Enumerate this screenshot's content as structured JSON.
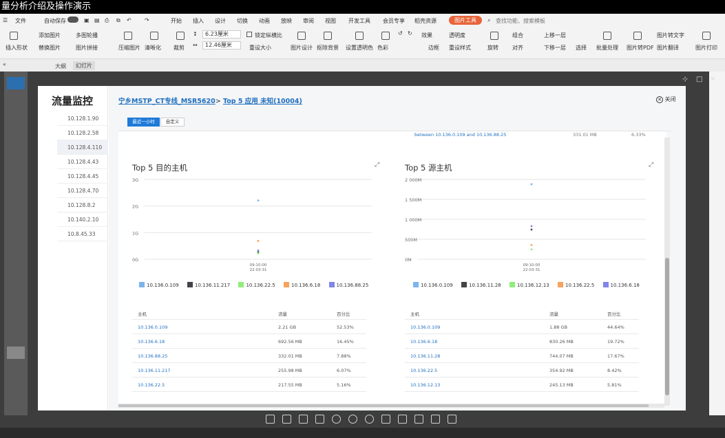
{
  "window": {
    "title": "量分析介绍及操作演示"
  },
  "menubar": {
    "file": "文件",
    "autosave": "自动保存",
    "tabs": [
      "开始",
      "插入",
      "设计",
      "切换",
      "动画",
      "放映",
      "审阅",
      "视图",
      "开发工具",
      "会员专享",
      "稻壳资源"
    ],
    "picture_tools": "图片工具",
    "search_placeholder": "查找功能、搜索模板"
  },
  "ribbon": {
    "insert_shape": "插入形状",
    "add_picture": "添加图片",
    "multi_crop": "多图轮播",
    "replace_picture": "替换图片",
    "picture_collage": "图片拼接",
    "compress": "压缩图片",
    "clarity": "清晰化",
    "crop": "裁剪",
    "height": "6.23厘米",
    "width": "12.46厘米",
    "lock_ratio": "锁定纵横比",
    "reset_size": "重设大小",
    "pic_design": "图片设计",
    "remove_bg": "抠除背景",
    "set_transparent": "设置透明色",
    "color": "色彩",
    "effect": "效果",
    "transparency": "透明度",
    "border": "边框",
    "reset_style": "重设样式",
    "rotate": "旋转",
    "combine": "组合",
    "align": "对齐",
    "bring_up": "上移一层",
    "send_down": "下移一层",
    "select": "选择",
    "batch": "批量处理",
    "to_pdf": "图片转PDF",
    "to_text": "图片转文字",
    "translate": "图片翻译",
    "print": "图片打印"
  },
  "subbar": {
    "outline": "大纲",
    "slides": "幻灯片"
  },
  "sidebar": {
    "title": "流量监控",
    "ips": [
      "10.128.1.90",
      "10.128.2.58",
      "10.128.4.110",
      "10.128.4.43",
      "10.128.4.45",
      "10.128.4.70",
      "10.128.8.2",
      "10.140.2.10",
      "10.8.45.33"
    ]
  },
  "header": {
    "crumb1": "宁乡MSTP_CT专线_MSR5620",
    "sep": ">",
    "crumb2": "Top 5 应用 未知(10004)",
    "close": "关闭"
  },
  "tabs": {
    "recent": "最近一小时",
    "custom": "自定义"
  },
  "top_fragment": {
    "text": "between 10.136.0.109 and 10.136.88.25",
    "size": "331.01 MB",
    "pct": "6.33%"
  },
  "panels": {
    "left": {
      "title": "Top 5 目的主机",
      "yticks": [
        "3G",
        "2G",
        "1G",
        "0G"
      ],
      "time_label": [
        "09:10:00",
        "22-03-31"
      ],
      "legend": [
        "10.136.0.109",
        "10.136.11.217",
        "10.136.22.5",
        "10.136.6.18",
        "10.136.88.25"
      ],
      "table_headers": [
        "主机",
        "流量",
        "百分比"
      ],
      "rows": [
        [
          "10.136.0.109",
          "2.21 GB",
          "52.53%"
        ],
        [
          "10.136.6.18",
          "692.56 MB",
          "16.45%"
        ],
        [
          "10.136.88.25",
          "332.01 MB",
          "7.88%"
        ],
        [
          "10.136.11.217",
          "255.98 MB",
          "6.07%"
        ],
        [
          "10.136.22.5",
          "217.55 MB",
          "5.16%"
        ]
      ]
    },
    "right": {
      "title": "Top 5 源主机",
      "yticks": [
        "2 000M",
        "1 500M",
        "1 000M",
        "500M",
        "0M"
      ],
      "time_label": [
        "09:10:00",
        "22-03-31"
      ],
      "legend": [
        "10.136.0.109",
        "10.136.11.28",
        "10.136.12.13",
        "10.136.22.5",
        "10.136.6.18"
      ],
      "table_headers": [
        "主机",
        "流量",
        "百分比"
      ],
      "rows": [
        [
          "10.136.0.109",
          "1.88 GB",
          "44.64%"
        ],
        [
          "10.136.6.18",
          "830.26 MB",
          "19.72%"
        ],
        [
          "10.136.11.28",
          "744.07 MB",
          "17.67%"
        ],
        [
          "10.136.22.5",
          "354.92 MB",
          "8.42%"
        ],
        [
          "10.136.12.13",
          "245.13 MB",
          "5.81%"
        ]
      ]
    }
  },
  "legend_colors": [
    "#7cb5ec",
    "#434348",
    "#90ed7d",
    "#f7a35c",
    "#8085e9"
  ],
  "chart_data": [
    {
      "type": "scatter",
      "title": "Top 5 目的主机",
      "x": [
        "09:10:00 22-03-31"
      ],
      "series": [
        {
          "name": "10.136.0.109",
          "values": [
            2.21
          ]
        },
        {
          "name": "10.136.11.217",
          "values": [
            0.26
          ]
        },
        {
          "name": "10.136.22.5",
          "values": [
            0.22
          ]
        },
        {
          "name": "10.136.6.18",
          "values": [
            0.69
          ]
        },
        {
          "name": "10.136.88.25",
          "values": [
            0.33
          ]
        }
      ],
      "ylim": [
        0,
        3
      ]
    },
    {
      "type": "scatter",
      "title": "Top 5 源主机",
      "x": [
        "09:10:00 22-03-31"
      ],
      "series": [
        {
          "name": "10.136.0.109",
          "values": [
            1880
          ]
        },
        {
          "name": "10.136.11.28",
          "values": [
            744
          ]
        },
        {
          "name": "10.136.12.13",
          "values": [
            245
          ]
        },
        {
          "name": "10.136.22.5",
          "values": [
            355
          ]
        },
        {
          "name": "10.136.6.18",
          "values": [
            830
          ]
        }
      ],
      "ylim": [
        0,
        2000
      ]
    }
  ]
}
